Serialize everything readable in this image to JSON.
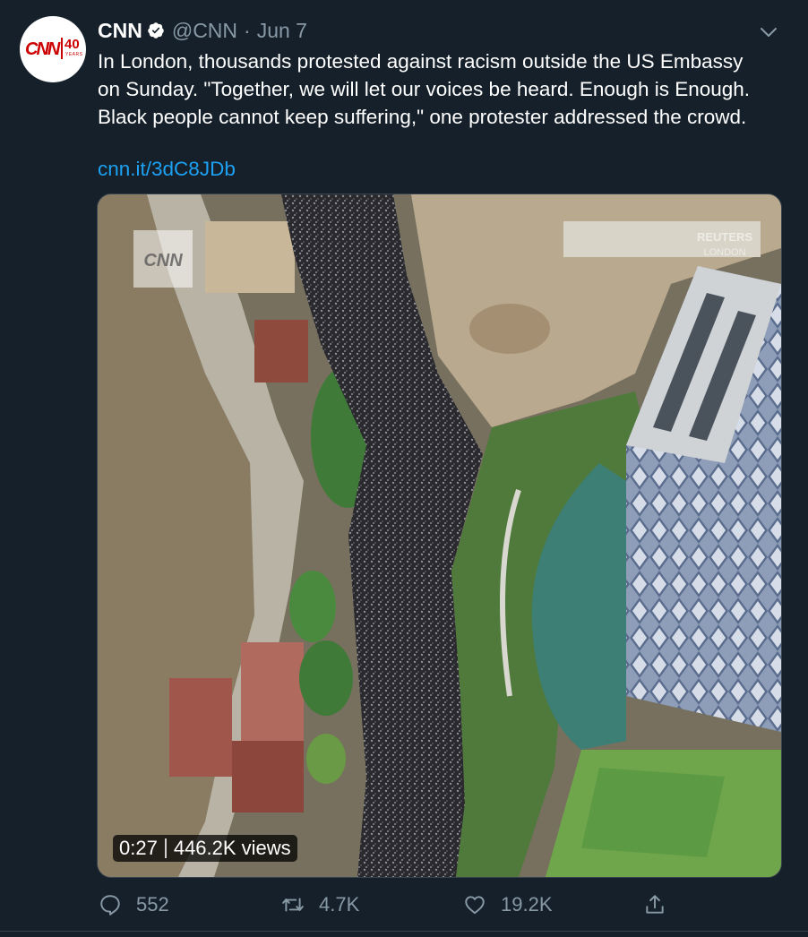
{
  "tweet": {
    "avatar": {
      "brand_text": "CNN",
      "badge_number": "40",
      "badge_sub": "YEARS",
      "brand_color": "#cc0000"
    },
    "author": {
      "name": "CNN",
      "handle": "@CNN",
      "separator": "·",
      "date": "Jun 7",
      "verified": true
    },
    "text": "In London, thousands protested against racism outside the US Embassy on Sunday. \"Together, we will let our voices be heard. Enough is Enough. Black people cannot keep suffering,\" one protester addressed the crowd.",
    "link": "cnn.it/3dC8JDb",
    "media": {
      "type": "video",
      "overlay_logo": "CNN",
      "watermark_line1": "REUTERS",
      "watermark_line2": "LONDON",
      "duration": "0:27",
      "views": "446.2K views"
    },
    "actions": {
      "replies": "552",
      "retweets": "4.7K",
      "likes": "19.2K"
    }
  },
  "colors": {
    "background": "#15202b",
    "secondary_text": "#8899a6",
    "link": "#1da1f2",
    "verified_badge": "#ffffff",
    "divider": "#38444d"
  },
  "icons": [
    "verified-icon",
    "caret-down-icon",
    "reply-icon",
    "retweet-icon",
    "like-icon",
    "share-icon"
  ]
}
